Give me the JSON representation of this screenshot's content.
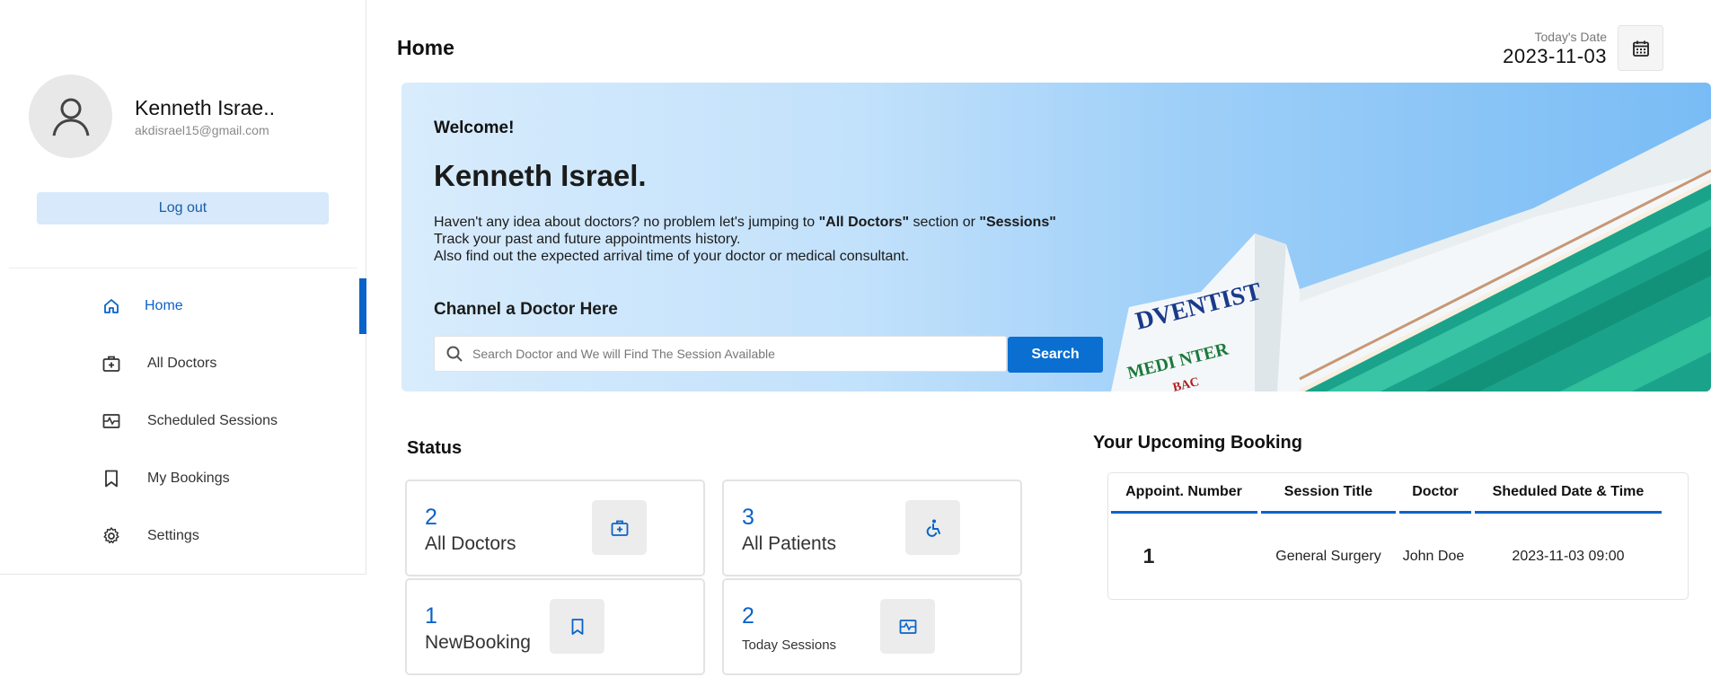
{
  "user": {
    "name": "Kenneth Israe..",
    "email": "akdisrael15@gmail.com",
    "logout_label": "Log out"
  },
  "nav": {
    "items": [
      {
        "label": "Home",
        "icon": "home-icon",
        "active": true
      },
      {
        "label": "All Doctors",
        "icon": "doctor-bag-icon",
        "active": false
      },
      {
        "label": "Scheduled Sessions",
        "icon": "schedule-icon",
        "active": false
      },
      {
        "label": "My Bookings",
        "icon": "bookmark-icon",
        "active": false
      },
      {
        "label": "Settings",
        "icon": "gear-icon",
        "active": false
      }
    ]
  },
  "header": {
    "title": "Home",
    "date_label": "Today's Date",
    "date_value": "2023-11-03"
  },
  "banner": {
    "welcome": "Welcome!",
    "name": "Kenneth Israel.",
    "desc_line1_a": "Haven't any idea about doctors? no problem let's jumping to ",
    "desc_line1_b": "\"All Doctors\"",
    "desc_line1_c": " section or ",
    "desc_line1_d": "\"Sessions\"",
    "desc_line2": "Track your past and future appointments history.",
    "desc_line3": "Also find out the expected arrival time of your doctor or medical consultant.",
    "channel_title": "Channel a Doctor Here",
    "search_placeholder": "Search Doctor and We will Find The Session Available",
    "search_button": "Search"
  },
  "status": {
    "title": "Status",
    "cards": [
      {
        "value": "2",
        "label": "All Doctors",
        "icon": "doctor-bag-icon"
      },
      {
        "value": "3",
        "label": "All Patients",
        "icon": "wheelchair-icon"
      },
      {
        "value": "1",
        "label": "NewBooking",
        "icon": "bookmark-icon"
      },
      {
        "value": "2",
        "label": "Today Sessions",
        "icon": "schedule-icon"
      }
    ]
  },
  "upcoming": {
    "title": "Your Upcoming Booking",
    "columns": [
      "Appoint. Number",
      "Session Title",
      "Doctor",
      "Sheduled Date & Time"
    ],
    "rows": [
      [
        "1",
        "General Surgery",
        "John Doe",
        "2023-11-03 09:00"
      ]
    ]
  },
  "colors": {
    "accent": "#0a63c9",
    "logout_bg": "#d7e9fa",
    "search_button_bg": "#0a6fd1"
  }
}
